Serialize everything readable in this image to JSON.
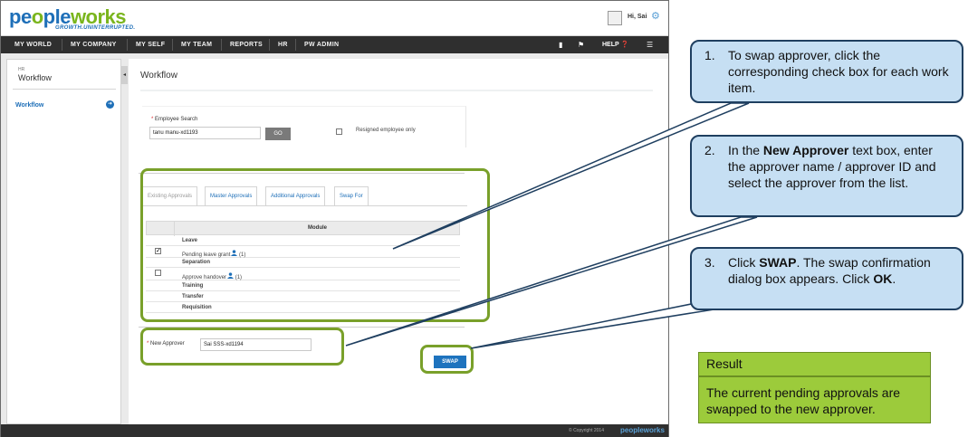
{
  "app": {
    "logo": {
      "text_left": "pe",
      "text_o1": "o",
      "text_mid": "ple",
      "text_rest": "works",
      "tagline": "GROWTH.UNINTERRUPTED."
    },
    "user_greeting": "Hi, Sai",
    "nav": [
      "MY WORLD",
      "MY COMPANY",
      "MY SELF",
      "MY TEAM",
      "REPORTS",
      "HR",
      "PW ADMIN"
    ],
    "help_label": "HELP",
    "sidebar": {
      "small": "HR",
      "title": "Workflow",
      "item": "Workflow"
    },
    "main": {
      "title": "Workflow",
      "employee_search_label": "Employee Search",
      "employee_search_value": "tanu manu-xd1193",
      "go_label": "GO",
      "resigned_label": "Resigned employee only",
      "tabs": [
        "Existing Approvals",
        "Master Approvals",
        "Additional Approvals",
        "Swap For"
      ],
      "module_header": "Module",
      "rows": [
        {
          "type": "category",
          "label": "Leave"
        },
        {
          "type": "item",
          "label": "Pending leave grant",
          "count": "(1)",
          "checked": true
        },
        {
          "type": "category",
          "label": "Separation"
        },
        {
          "type": "item",
          "label": "Approve handover",
          "count": "(1)",
          "checked": false
        },
        {
          "type": "category",
          "label": "Training"
        },
        {
          "type": "category",
          "label": "Transfer"
        },
        {
          "type": "category",
          "label": "Requisition"
        }
      ],
      "new_approver_label": "New Approver",
      "new_approver_value": "Sai SSS-xd1194",
      "swap_label": "SWAP"
    },
    "footer": {
      "copyright": "© Copyright 2014",
      "logo": "peopleworks"
    }
  },
  "callouts": {
    "step1": {
      "num": "1.",
      "text": "To swap approver, click the corresponding check box for each work item."
    },
    "step2": {
      "num": "2.",
      "pre": "In the ",
      "bold": "New Approver",
      "post": " text box, enter the approver name / approver ID and select the approver from the list."
    },
    "step3": {
      "num": "3.",
      "pre": "Click ",
      "bold": "SWAP",
      "mid": ". The swap confirmation dialog box appears. Click ",
      "bold2": "OK",
      "post": "."
    }
  },
  "result": {
    "title": "Result",
    "text": "The current pending approvals are swapped to the new approver."
  },
  "colors": {
    "accent_green": "#79a02a",
    "callout_fill": "#c6dff3",
    "result_fill": "#9ccb3b",
    "brand_blue": "#1e6fb8"
  }
}
